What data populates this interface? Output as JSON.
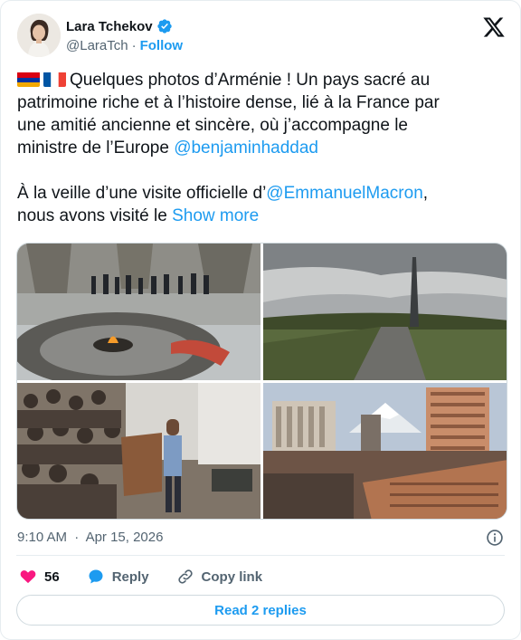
{
  "author": {
    "display_name": "Lara Tchekov",
    "handle": "@LaraTch",
    "separator": "·",
    "follow_label": "Follow"
  },
  "tweet": {
    "line1": "Quelques photos d’Arménie ! Un pays sacré au",
    "line2": "patrimoine riche et à l’histoire dense, lié à la France par",
    "line3": "une amitié ancienne et sincère, où j’accompagne le",
    "line4_prefix": "ministre de l’Europe ",
    "mention1": "@benjaminhaddad",
    "line5_prefix": "À la veille d’une visite officielle d’",
    "mention2": "@EmmanuelMacron",
    "line5_suffix": ",",
    "line6_prefix": "nous avons visité le ",
    "show_more": "Show more"
  },
  "meta": {
    "time": "9:10 AM",
    "separator": "·",
    "date": "Apr 15, 2026"
  },
  "actions": {
    "like_count": "56",
    "reply_label": "Reply",
    "copy_label": "Copy link"
  },
  "read_replies_label": "Read 2 replies",
  "colors": {
    "accent": "#1d9bf0",
    "like": "#f91880",
    "text": "#0f1419",
    "muted": "#536471"
  },
  "icons": [
    "verified-badge-icon",
    "x-logo-icon",
    "armenia-flag-icon",
    "france-flag-icon",
    "info-icon",
    "heart-icon",
    "reply-bubble-icon",
    "link-icon"
  ]
}
